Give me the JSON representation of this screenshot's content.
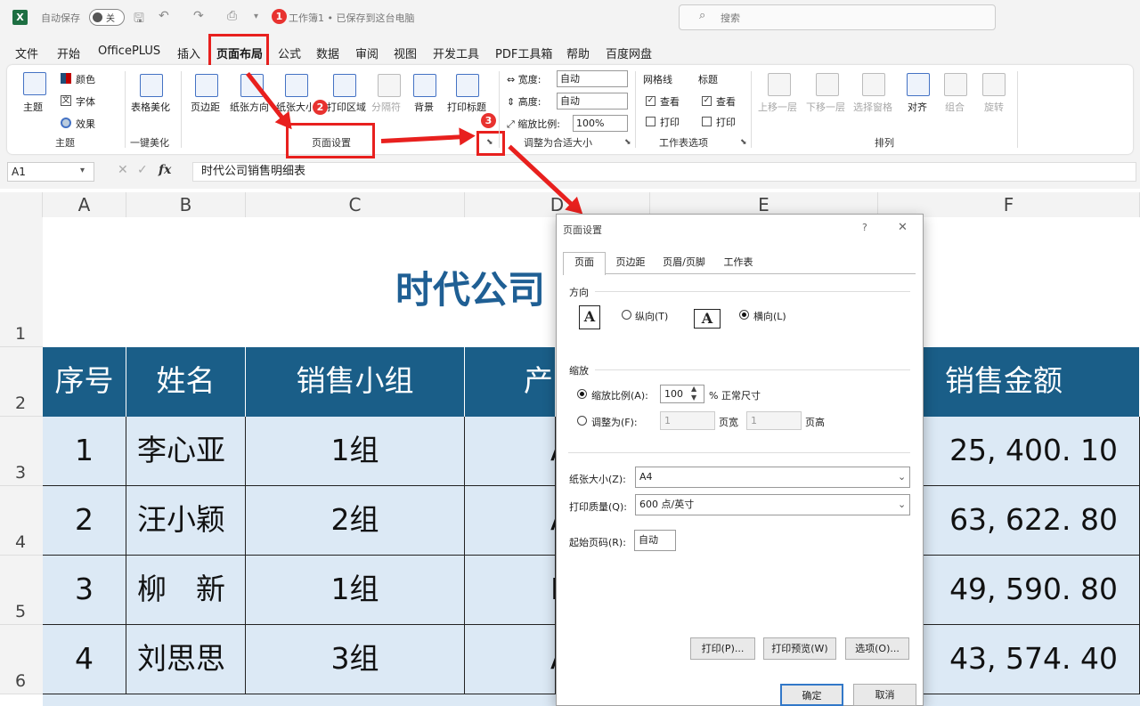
{
  "titlebar": {
    "autosave": "自动保存",
    "toggle": "关",
    "filename": "工作簿1 • 已保存到这台电脑",
    "search_placeholder": "搜索"
  },
  "badges": [
    "1",
    "2",
    "3"
  ],
  "tabs": [
    "文件",
    "开始",
    "OfficePLUS",
    "插入",
    "页面布局",
    "公式",
    "数据",
    "审阅",
    "视图",
    "开发工具",
    "PDF工具箱",
    "帮助",
    "百度网盘"
  ],
  "ribbon": {
    "theme": {
      "themes": "主题",
      "colors": "颜色",
      "fonts": "字体",
      "effects": "效果",
      "group": "主题"
    },
    "beautify": {
      "btn": "表格美化",
      "group": "一键美化"
    },
    "page_setup": {
      "margins": "页边距",
      "orientation": "纸张方向",
      "size": "纸张大小",
      "print_area": "打印区域",
      "breaks": "分隔符",
      "background": "背景",
      "print_titles": "打印标题",
      "group": "页面设置"
    },
    "scale": {
      "width_label": "宽度:",
      "width": "自动",
      "height_label": "高度:",
      "height": "自动",
      "scale_label": "缩放比例:",
      "scale": "100%",
      "group": "调整为合适大小"
    },
    "sheet_options": {
      "gridlines": "网格线",
      "headings": "标题",
      "view": "查看",
      "print": "打印",
      "group": "工作表选项"
    },
    "arrange": {
      "forward": "上移一层",
      "backward": "下移一层",
      "pane": "选择窗格",
      "align": "对齐",
      "group_btn": "组合",
      "rotate": "旋转",
      "group": "排列"
    }
  },
  "formula": {
    "cell": "A1",
    "fx": "fx",
    "content": "时代公司销售明细表"
  },
  "columns": [
    "A",
    "B",
    "C",
    "D",
    "E",
    "F"
  ],
  "rows": [
    "1",
    "2",
    "3",
    "4",
    "5",
    "6"
  ],
  "sheet": {
    "title": "时代公司",
    "headers": [
      "序号",
      "姓名",
      "销售小组",
      "产",
      "销售金额"
    ],
    "data": [
      {
        "no": "1",
        "name": "李心亚",
        "group": "1组",
        "prod": "A",
        "amount": "25, 400. 10"
      },
      {
        "no": "2",
        "name": "汪小颖",
        "group": "2组",
        "prod": "A",
        "amount": "63, 622. 80"
      },
      {
        "no": "3",
        "name": "柳　新",
        "group": "1组",
        "prod": "B",
        "amount": "49, 590. 80"
      },
      {
        "no": "4",
        "name": "刘思思",
        "group": "3组",
        "prod": "A",
        "amount": "43, 574. 40"
      }
    ]
  },
  "dialog": {
    "title": "页面设置",
    "help": "?",
    "close": "✕",
    "tabs": [
      "页面",
      "页边距",
      "页眉/页脚",
      "工作表"
    ],
    "orientation": {
      "label": "方向",
      "portrait": "纵向(T)",
      "landscape": "横向(L)"
    },
    "scaling": {
      "label": "缩放",
      "adjust_to": "缩放比例(A):",
      "adjust_val": "100",
      "normal": "% 正常尺寸",
      "fit_to": "调整为(F):",
      "pages_wide_val": "1",
      "pages_wide": "页宽",
      "pages_tall_val": "1",
      "pages_tall": "页高"
    },
    "paper_size_label": "纸张大小(Z):",
    "paper_size": "A4",
    "quality_label": "打印质量(Q):",
    "quality": "600 点/英寸",
    "first_page_label": "起始页码(R):",
    "first_page": "自动",
    "buttons": {
      "print": "打印(P)...",
      "preview": "打印预览(W)",
      "options": "选项(O)...",
      "ok": "确定",
      "cancel": "取消"
    }
  },
  "colors": {
    "accent_red": "#e8201e",
    "header_blue": "#1a5e88",
    "row_fill": "#dce9f5",
    "title_blue": "#1f5f94"
  }
}
